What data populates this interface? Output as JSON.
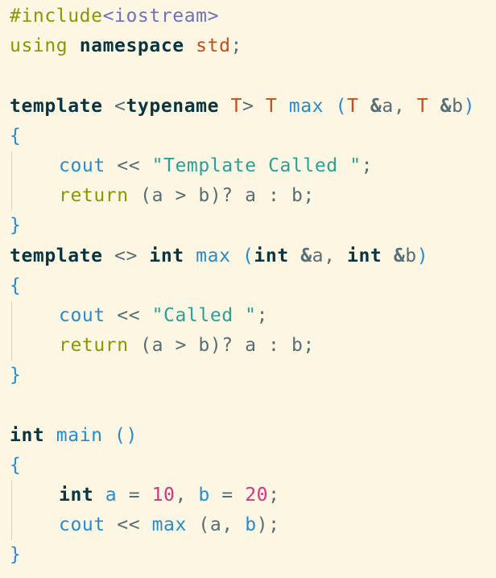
{
  "editor": {
    "theme_colors": {
      "background": "#fdf6e3",
      "text": "#586e75",
      "keyword_bold": "#073642",
      "preprocessor": "#859900",
      "include": "#6c71c4",
      "namespace": "#cb4b16",
      "type_param": "#cb4b16",
      "function": "#268bd2",
      "bracket": "#268bd2",
      "string": "#2aa198",
      "number": "#d33682",
      "indent_guide": "#d9d2bd"
    },
    "lines": [
      {
        "indent": false,
        "tokens": [
          {
            "t": "#include",
            "c": "#859900"
          },
          {
            "t": "<iostream>",
            "c": "#6c71c4"
          }
        ]
      },
      {
        "indent": false,
        "tokens": [
          {
            "t": "using ",
            "c": "#859900"
          },
          {
            "t": "namespace",
            "c": "#073642",
            "b": true
          },
          {
            "t": " ",
            "c": "#586e75"
          },
          {
            "t": "std",
            "c": "#cb4b16"
          },
          {
            "t": ";",
            "c": "#586e75"
          }
        ]
      },
      {
        "indent": false,
        "tokens": []
      },
      {
        "indent": false,
        "tokens": [
          {
            "t": "template",
            "c": "#073642",
            "b": true
          },
          {
            "t": " <",
            "c": "#586e75"
          },
          {
            "t": "typename",
            "c": "#073642",
            "b": true
          },
          {
            "t": " ",
            "c": "#586e75"
          },
          {
            "t": "T",
            "c": "#cb4b16"
          },
          {
            "t": "> ",
            "c": "#586e75"
          },
          {
            "t": "T",
            "c": "#cb4b16"
          },
          {
            "t": " ",
            "c": "#586e75"
          },
          {
            "t": "max",
            "c": "#268bd2"
          },
          {
            "t": " ",
            "c": "#586e75"
          },
          {
            "t": "(",
            "c": "#268bd2"
          },
          {
            "t": "T",
            "c": "#cb4b16"
          },
          {
            "t": " &",
            "c": "#586e75",
            "b": true
          },
          {
            "t": "a",
            "c": "#586e75"
          },
          {
            "t": ", ",
            "c": "#586e75"
          },
          {
            "t": "T",
            "c": "#cb4b16"
          },
          {
            "t": " &",
            "c": "#586e75",
            "b": true
          },
          {
            "t": "b",
            "c": "#586e75"
          },
          {
            "t": ")",
            "c": "#268bd2"
          }
        ]
      },
      {
        "indent": false,
        "tokens": [
          {
            "t": "{",
            "c": "#268bd2"
          }
        ]
      },
      {
        "indent": true,
        "tokens": [
          {
            "t": "cout",
            "c": "#268bd2"
          },
          {
            "t": " << ",
            "c": "#586e75"
          },
          {
            "t": "\"Template Called \"",
            "c": "#2aa198"
          },
          {
            "t": ";",
            "c": "#586e75"
          }
        ]
      },
      {
        "indent": true,
        "tokens": [
          {
            "t": "return",
            "c": "#859900"
          },
          {
            "t": " (a > b)? a : b;",
            "c": "#586e75"
          }
        ]
      },
      {
        "indent": false,
        "tokens": [
          {
            "t": "}",
            "c": "#268bd2"
          }
        ]
      },
      {
        "indent": false,
        "tokens": [
          {
            "t": "template",
            "c": "#073642",
            "b": true
          },
          {
            "t": " <> ",
            "c": "#586e75"
          },
          {
            "t": "int",
            "c": "#073642",
            "b": true
          },
          {
            "t": " ",
            "c": "#586e75"
          },
          {
            "t": "max",
            "c": "#268bd2"
          },
          {
            "t": " ",
            "c": "#586e75"
          },
          {
            "t": "(",
            "c": "#268bd2"
          },
          {
            "t": "int",
            "c": "#073642",
            "b": true
          },
          {
            "t": " &",
            "c": "#586e75",
            "b": true
          },
          {
            "t": "a",
            "c": "#586e75"
          },
          {
            "t": ", ",
            "c": "#586e75"
          },
          {
            "t": "int",
            "c": "#073642",
            "b": true
          },
          {
            "t": " &",
            "c": "#586e75",
            "b": true
          },
          {
            "t": "b",
            "c": "#586e75"
          },
          {
            "t": ")",
            "c": "#268bd2"
          }
        ]
      },
      {
        "indent": false,
        "tokens": [
          {
            "t": "{",
            "c": "#268bd2"
          }
        ]
      },
      {
        "indent": true,
        "tokens": [
          {
            "t": "cout",
            "c": "#268bd2"
          },
          {
            "t": " << ",
            "c": "#586e75"
          },
          {
            "t": "\"Called \"",
            "c": "#2aa198"
          },
          {
            "t": ";",
            "c": "#586e75"
          }
        ]
      },
      {
        "indent": true,
        "tokens": [
          {
            "t": "return",
            "c": "#859900"
          },
          {
            "t": " (a > b)? a : b;",
            "c": "#586e75"
          }
        ]
      },
      {
        "indent": false,
        "tokens": [
          {
            "t": "}",
            "c": "#268bd2"
          }
        ]
      },
      {
        "indent": false,
        "tokens": []
      },
      {
        "indent": false,
        "tokens": [
          {
            "t": "int",
            "c": "#073642",
            "b": true
          },
          {
            "t": " ",
            "c": "#586e75"
          },
          {
            "t": "main",
            "c": "#268bd2"
          },
          {
            "t": " ",
            "c": "#586e75"
          },
          {
            "t": "()",
            "c": "#268bd2"
          }
        ]
      },
      {
        "indent": false,
        "tokens": [
          {
            "t": "{",
            "c": "#268bd2"
          }
        ]
      },
      {
        "indent": true,
        "tokens": [
          {
            "t": "int",
            "c": "#073642",
            "b": true
          },
          {
            "t": " ",
            "c": "#586e75"
          },
          {
            "t": "a",
            "c": "#268bd2"
          },
          {
            "t": " = ",
            "c": "#586e75"
          },
          {
            "t": "10",
            "c": "#d33682"
          },
          {
            "t": ", ",
            "c": "#586e75"
          },
          {
            "t": "b",
            "c": "#268bd2"
          },
          {
            "t": " = ",
            "c": "#586e75"
          },
          {
            "t": "20",
            "c": "#d33682"
          },
          {
            "t": ";",
            "c": "#586e75"
          }
        ]
      },
      {
        "indent": true,
        "tokens": [
          {
            "t": "cout",
            "c": "#268bd2"
          },
          {
            "t": " << ",
            "c": "#586e75"
          },
          {
            "t": "max",
            "c": "#268bd2"
          },
          {
            "t": " (",
            "c": "#586e75"
          },
          {
            "t": "a",
            "c": "#586e75"
          },
          {
            "t": ", ",
            "c": "#586e75"
          },
          {
            "t": "b",
            "c": "#268bd2"
          },
          {
            "t": ");",
            "c": "#586e75"
          }
        ]
      },
      {
        "indent": false,
        "tokens": [
          {
            "t": "}",
            "c": "#268bd2"
          }
        ]
      }
    ]
  }
}
